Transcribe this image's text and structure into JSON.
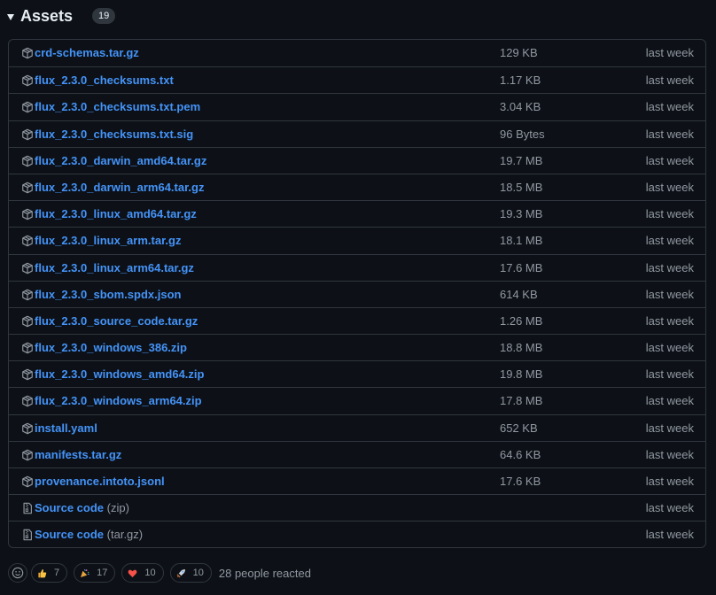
{
  "header": {
    "title": "Assets",
    "count": "19"
  },
  "assets": [
    {
      "name": "crd-schemas.tar.gz",
      "size": "129 KB",
      "time": "last week",
      "icon": "package-icon"
    },
    {
      "name": "flux_2.3.0_checksums.txt",
      "size": "1.17 KB",
      "time": "last week",
      "icon": "package-icon"
    },
    {
      "name": "flux_2.3.0_checksums.txt.pem",
      "size": "3.04 KB",
      "time": "last week",
      "icon": "package-icon"
    },
    {
      "name": "flux_2.3.0_checksums.txt.sig",
      "size": "96 Bytes",
      "time": "last week",
      "icon": "package-icon"
    },
    {
      "name": "flux_2.3.0_darwin_amd64.tar.gz",
      "size": "19.7 MB",
      "time": "last week",
      "icon": "package-icon"
    },
    {
      "name": "flux_2.3.0_darwin_arm64.tar.gz",
      "size": "18.5 MB",
      "time": "last week",
      "icon": "package-icon"
    },
    {
      "name": "flux_2.3.0_linux_amd64.tar.gz",
      "size": "19.3 MB",
      "time": "last week",
      "icon": "package-icon"
    },
    {
      "name": "flux_2.3.0_linux_arm.tar.gz",
      "size": "18.1 MB",
      "time": "last week",
      "icon": "package-icon"
    },
    {
      "name": "flux_2.3.0_linux_arm64.tar.gz",
      "size": "17.6 MB",
      "time": "last week",
      "icon": "package-icon"
    },
    {
      "name": "flux_2.3.0_sbom.spdx.json",
      "size": "614 KB",
      "time": "last week",
      "icon": "package-icon"
    },
    {
      "name": "flux_2.3.0_source_code.tar.gz",
      "size": "1.26 MB",
      "time": "last week",
      "icon": "package-icon"
    },
    {
      "name": "flux_2.3.0_windows_386.zip",
      "size": "18.8 MB",
      "time": "last week",
      "icon": "package-icon"
    },
    {
      "name": "flux_2.3.0_windows_amd64.zip",
      "size": "19.8 MB",
      "time": "last week",
      "icon": "package-icon"
    },
    {
      "name": "flux_2.3.0_windows_arm64.zip",
      "size": "17.8 MB",
      "time": "last week",
      "icon": "package-icon"
    },
    {
      "name": "install.yaml",
      "size": "652 KB",
      "time": "last week",
      "icon": "package-icon"
    },
    {
      "name": "manifests.tar.gz",
      "size": "64.6 KB",
      "time": "last week",
      "icon": "package-icon"
    },
    {
      "name": "provenance.intoto.jsonl",
      "size": "17.6 KB",
      "time": "last week",
      "icon": "package-icon"
    },
    {
      "name": "Source code",
      "suffix": "(zip)",
      "size": "",
      "time": "last week",
      "icon": "file-zip-icon"
    },
    {
      "name": "Source code",
      "suffix": "(tar.gz)",
      "size": "",
      "time": "last week",
      "icon": "file-zip-icon"
    }
  ],
  "reactions": {
    "items": [
      {
        "icon": "thumbs-up-icon",
        "count": "7"
      },
      {
        "icon": "tada-icon",
        "count": "17"
      },
      {
        "icon": "heart-icon",
        "count": "10"
      },
      {
        "icon": "rocket-icon",
        "count": "10"
      }
    ],
    "summary": "28 people reacted"
  },
  "colors": {
    "background": "#0d1117",
    "link": "#4493f8",
    "muted": "#9198a1",
    "border": "#30363d"
  }
}
